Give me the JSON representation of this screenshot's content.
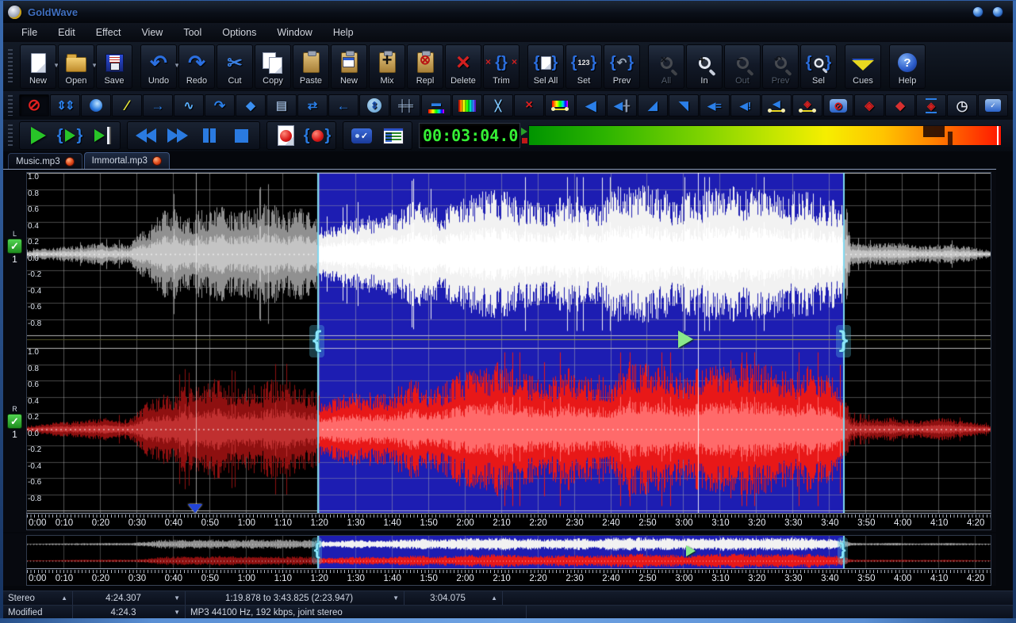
{
  "window": {
    "title": "GoldWave",
    "controls": [
      {
        "name": "minimize"
      },
      {
        "name": "close"
      }
    ]
  },
  "menu": {
    "items": [
      "File",
      "Edit",
      "Effect",
      "View",
      "Tool",
      "Options",
      "Window",
      "Help"
    ]
  },
  "toolbar": {
    "groups": [
      [
        {
          "label": "New",
          "icon": "page",
          "enabled": true,
          "dropdown": true
        },
        {
          "label": "Open",
          "icon": "folder",
          "enabled": true,
          "dropdown": true
        },
        {
          "label": "Save",
          "icon": "save",
          "enabled": true
        }
      ],
      [
        {
          "label": "Undo",
          "icon": "undo",
          "enabled": true,
          "dropdown": true
        },
        {
          "label": "Redo",
          "icon": "redo",
          "enabled": true
        },
        {
          "label": "Cut",
          "icon": "cut",
          "enabled": true
        },
        {
          "label": "Copy",
          "icon": "copy",
          "enabled": true
        },
        {
          "label": "Paste",
          "icon": "paste",
          "enabled": true
        },
        {
          "label": "New",
          "icon": "paste-new",
          "enabled": true
        },
        {
          "label": "Mix",
          "icon": "mix",
          "enabled": true
        },
        {
          "label": "Repl",
          "icon": "repl",
          "enabled": true
        },
        {
          "label": "Delete",
          "icon": "delete",
          "enabled": true
        },
        {
          "label": "Trim",
          "icon": "trim",
          "enabled": true
        }
      ],
      [
        {
          "label": "Sel All",
          "icon": "sel-all",
          "enabled": true
        },
        {
          "label": "Set",
          "icon": "set",
          "enabled": true
        },
        {
          "label": "Prev",
          "icon": "prev-sel",
          "enabled": true
        }
      ],
      [
        {
          "label": "All",
          "icon": "zoom-all",
          "enabled": false
        },
        {
          "label": "In",
          "icon": "zoom-in",
          "enabled": true
        },
        {
          "label": "Out",
          "icon": "zoom-out",
          "enabled": false
        },
        {
          "label": "Prev",
          "icon": "zoom-prev",
          "enabled": false
        },
        {
          "label": "Sel",
          "icon": "zoom-sel",
          "enabled": true
        }
      ],
      [
        {
          "label": "Cues",
          "icon": "cues",
          "enabled": true
        }
      ],
      [
        {
          "label": "Help",
          "icon": "help",
          "enabled": true
        }
      ]
    ]
  },
  "effects": {
    "buttons": [
      {
        "name": "disable"
      },
      {
        "name": "adjust"
      },
      {
        "name": "sphere"
      },
      {
        "name": "expression"
      },
      {
        "name": "pitch"
      },
      {
        "name": "doppler"
      },
      {
        "name": "reverse"
      },
      {
        "name": "echo"
      },
      {
        "name": "playlist"
      },
      {
        "name": "compress"
      },
      {
        "name": "flange"
      },
      {
        "name": "dynamics"
      },
      {
        "name": "equalizer"
      },
      {
        "name": "filter"
      },
      {
        "name": "spectrum-filter"
      },
      {
        "name": "interpolate"
      },
      {
        "name": "silence-reduce"
      },
      {
        "name": "spectrum"
      },
      {
        "name": "volume"
      },
      {
        "name": "volume-slider"
      },
      {
        "name": "fade-in"
      },
      {
        "name": "fade-out"
      },
      {
        "name": "match-volume"
      },
      {
        "name": "maximize"
      },
      {
        "name": "shape-volume"
      },
      {
        "name": "pan-shape"
      },
      {
        "name": "noise-gate"
      },
      {
        "name": "mechanize"
      },
      {
        "name": "flutter"
      },
      {
        "name": "offset"
      },
      {
        "name": "timewarp"
      },
      {
        "name": "chat"
      }
    ]
  },
  "transport": {
    "groups": [
      [
        "play",
        "play-selection",
        "play-from"
      ],
      [
        "rewind",
        "fast-forward",
        "pause",
        "stop"
      ],
      [
        "record",
        "record-selection"
      ],
      [
        "record-options",
        "monitor"
      ]
    ]
  },
  "lcd": {
    "time": "00:03:04.0"
  },
  "tabs": [
    {
      "label": "Music.mp3",
      "active": false
    },
    {
      "label": "Immortal.mp3",
      "active": true
    }
  ],
  "channels": [
    {
      "label": "L",
      "track": "1",
      "checked": true
    },
    {
      "label": "R",
      "track": "1",
      "checked": true
    }
  ],
  "amplitude_labels": [
    "1.0",
    "0.8",
    "0.6",
    "0.4",
    "0.2",
    "0.0",
    "-0.2",
    "-0.4",
    "-0.6",
    "-0.8"
  ],
  "time_axis": {
    "labels": [
      "0:00",
      "0:10",
      "0:20",
      "0:30",
      "0:40",
      "0:50",
      "1:00",
      "1:10",
      "1:20",
      "1:30",
      "1:40",
      "1:50",
      "2:00",
      "2:10",
      "2:20",
      "2:30",
      "2:40",
      "2:50",
      "3:00",
      "3:10",
      "3:20",
      "3:30",
      "3:40",
      "3:50",
      "4:00",
      "4:10",
      "4:20"
    ]
  },
  "waveform": {
    "total_seconds": 264.307,
    "selection_start_s": 79.878,
    "selection_end_s": 223.825,
    "playback_s": 184.075,
    "cue_s": 46.4,
    "colors": {
      "selection_bg": "#1d1db2",
      "left_in": "#f2f2f2",
      "left_in_core": "#ffffff",
      "left_out": "#909090",
      "left_out_core": "#c4c4c4",
      "right_in": "#e81818",
      "right_in_core": "#ff6a6a",
      "right_out": "#8e1010",
      "right_out_core": "#c03030",
      "grid": "rgba(170,170,170,0.5)",
      "bracket": "#7fd8f0",
      "marker": "#8ae88a",
      "cue": "#2244d8"
    }
  },
  "status": {
    "row1": [
      {
        "text": "Stereo",
        "arrow": "▲",
        "name": "channel-mode-cell"
      },
      {
        "text": "4:24.307",
        "arrow": "▼",
        "name": "total-length-cell"
      },
      {
        "text": "1:19.878 to 3:43.825 (2:23.947)",
        "arrow": "▼",
        "name": "selection-range-cell"
      },
      {
        "text": "3:04.075",
        "arrow": "▲",
        "name": "position-cell"
      }
    ],
    "row2": [
      {
        "text": "Modified",
        "arrow": "",
        "name": "modified-cell"
      },
      {
        "text": "4:24.3",
        "arrow": "▼",
        "name": "length-short-cell"
      },
      {
        "text": "MP3 44100 Hz, 192 kbps, joint stereo",
        "arrow": "",
        "name": "format-info-cell"
      }
    ]
  }
}
